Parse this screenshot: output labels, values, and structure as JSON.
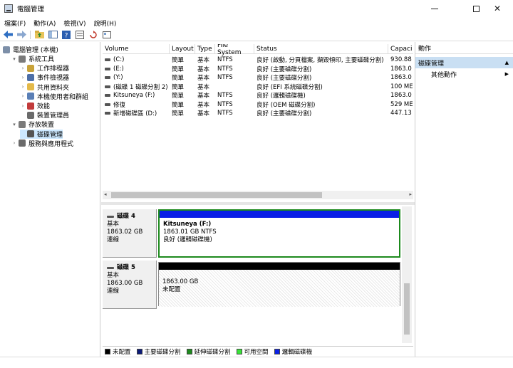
{
  "window": {
    "title": "電腦管理"
  },
  "menu": [
    "檔案(F)",
    "動作(A)",
    "檢視(V)",
    "說明(H)"
  ],
  "toolbar_icons": [
    "back-arrow-icon",
    "forward-arrow-icon",
    "up-folder-icon",
    "show-tree-icon",
    "help-icon",
    "properties-icon",
    "refresh-icon",
    "export-icon"
  ],
  "tree": {
    "root": "電腦管理 (本機)",
    "items": [
      {
        "label": "系統工具",
        "indent": 1,
        "expand": "▾",
        "icon": "tools-icon",
        "color": "#7a7a7a"
      },
      {
        "label": "工作排程器",
        "indent": 2,
        "expand": "›",
        "icon": "clock-icon",
        "color": "#c9a33a"
      },
      {
        "label": "事件檢視器",
        "indent": 2,
        "expand": "›",
        "icon": "event-viewer-icon",
        "color": "#4d6fa8"
      },
      {
        "label": "共用資料夾",
        "indent": 2,
        "expand": "›",
        "icon": "shared-folder-icon",
        "color": "#e3b94a"
      },
      {
        "label": "本機使用者和群組",
        "indent": 2,
        "expand": "›",
        "icon": "users-icon",
        "color": "#5a7fb6"
      },
      {
        "label": "效能",
        "indent": 2,
        "expand": "›",
        "icon": "performance-icon",
        "color": "#c23b3b"
      },
      {
        "label": "裝置管理員",
        "indent": 2,
        "expand": "",
        "icon": "device-manager-icon",
        "color": "#6a6a6a"
      },
      {
        "label": "存放裝置",
        "indent": 1,
        "expand": "▾",
        "icon": "storage-icon",
        "color": "#7a7a7a"
      },
      {
        "label": "磁碟管理",
        "indent": 2,
        "expand": "",
        "icon": "disk-icon",
        "color": "#555555",
        "selected": true
      },
      {
        "label": "服務與應用程式",
        "indent": 1,
        "expand": "›",
        "icon": "services-icon",
        "color": "#6a6a6a"
      }
    ]
  },
  "volumes": {
    "headers": [
      "Volume",
      "Layout",
      "Type",
      "File System",
      "Status",
      "Capaci"
    ],
    "rows": [
      [
        "(C:)",
        "簡單",
        "基本",
        "NTFS",
        "良好 (啟動, 分頁檔案, 擷毀傾印, 主要磁碟分割)",
        "930.88"
      ],
      [
        "(E:)",
        "簡單",
        "基本",
        "NTFS",
        "良好 (主要磁碟分割)",
        "1863.0"
      ],
      [
        "(Y:)",
        "簡單",
        "基本",
        "NTFS",
        "良好 (主要磁碟分割)",
        "1863.0"
      ],
      [
        "(磁碟 1 磁碟分割 2)",
        "簡單",
        "基本",
        "",
        "良好 (EFI 系統磁碟分割)",
        "100 ME"
      ],
      [
        "Kitsuneya (F:)",
        "簡單",
        "基本",
        "NTFS",
        "良好 (邏輯磁碟機)",
        "1863.0"
      ],
      [
        "修復",
        "簡單",
        "基本",
        "NTFS",
        "良好 (OEM 磁碟分割)",
        "529 ME"
      ],
      [
        "新增磁碟區 (D:)",
        "簡單",
        "基本",
        "NTFS",
        "良好 (主要磁碟分割)",
        "447.13"
      ]
    ]
  },
  "disks": [
    {
      "name": "磁碟 4",
      "type": "基本",
      "size": "1863.02 GB",
      "status": "連線",
      "partition": {
        "title": "Kitsuneya  (F:)",
        "detail": "1863.01 GB NTFS",
        "state": "良好 (邏輯磁碟機)",
        "bar_color": "#0a1fe6"
      }
    },
    {
      "name": "磁碟 5",
      "type": "基本",
      "size": "1863.00 GB",
      "status": "連線",
      "partition": {
        "title": "",
        "detail": "1863.00 GB",
        "state": "未配置",
        "bar_color": "#000000"
      }
    }
  ],
  "legend": [
    {
      "label": "未配置",
      "color": "#000000"
    },
    {
      "label": "主要磁碟分割",
      "color": "#0b1a77"
    },
    {
      "label": "延伸磁碟分割",
      "color": "#1e8a1e"
    },
    {
      "label": "可用空間",
      "color": "#39e339"
    },
    {
      "label": "邏輯磁碟機",
      "color": "#0a1fe6"
    }
  ],
  "actions": {
    "header": "動作",
    "selected": "磁碟管理",
    "more": "其他動作"
  }
}
